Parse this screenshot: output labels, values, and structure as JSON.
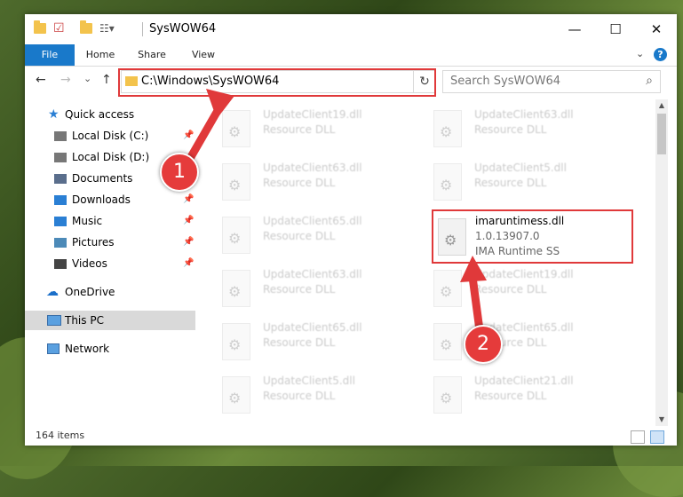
{
  "window": {
    "title": "SysWOW64",
    "minimize": "—",
    "maximize": "☐",
    "close": "✕"
  },
  "ribbon": {
    "tabs": [
      "File",
      "Home",
      "Share",
      "View"
    ],
    "help": "?",
    "caret": "⌄"
  },
  "address": {
    "path": "C:\\Windows\\SysWOW64",
    "caret": "⌄",
    "refresh": "↻"
  },
  "search": {
    "placeholder": "Search SysWOW64",
    "icon": "⌕"
  },
  "nav_buttons": {
    "back": "←",
    "forward": "→",
    "recent": "⌄",
    "up": "↑"
  },
  "nav": {
    "quick_access": "Quick access",
    "items": [
      {
        "label": "Local Disk (C:)",
        "icon": "drive-icon",
        "pinned": true
      },
      {
        "label": "Local Disk (D:)",
        "icon": "drive-icon",
        "pinned": false
      },
      {
        "label": "Documents",
        "icon": "documents-icon",
        "pinned": true
      },
      {
        "label": "Downloads",
        "icon": "downloads-icon",
        "pinned": true
      },
      {
        "label": "Music",
        "icon": "music-icon",
        "pinned": true
      },
      {
        "label": "Pictures",
        "icon": "pictures-icon",
        "pinned": true
      },
      {
        "label": "Videos",
        "icon": "videos-icon",
        "pinned": true
      }
    ],
    "onedrive": "OneDrive",
    "this_pc": "This PC",
    "network": "Network",
    "pin_glyph": "📌"
  },
  "files": [
    {
      "name": "UpdateClient19.dll",
      "desc": "Resource DLL",
      "col": 0,
      "row": 0
    },
    {
      "name": "UpdateClient63.dll",
      "desc": "Resource DLL",
      "col": 1,
      "row": 0
    },
    {
      "name": "UpdateClient63.dll",
      "desc": "Resource DLL",
      "col": 0,
      "row": 1
    },
    {
      "name": "UpdateClient5.dll",
      "desc": "Resource DLL",
      "col": 1,
      "row": 1
    },
    {
      "name": "UpdateClient65.dll",
      "desc": "Resource DLL",
      "col": 0,
      "row": 2
    },
    {
      "name": "UpdateClient63.dll",
      "desc": "Resource DLL",
      "col": 0,
      "row": 3
    },
    {
      "name": "UpdateClient19.dll",
      "desc": "Resource DLL",
      "col": 1,
      "row": 3
    },
    {
      "name": "UpdateClient65.dll",
      "desc": "Resource DLL",
      "col": 0,
      "row": 4
    },
    {
      "name": "UpdateClient65.dll",
      "desc": "Resource DLL",
      "col": 1,
      "row": 4
    },
    {
      "name": "UpdateClient5.dll",
      "desc": "Resource DLL",
      "col": 0,
      "row": 5
    },
    {
      "name": "UpdateClient21.dll",
      "desc": "Resource DLL",
      "col": 1,
      "row": 5
    }
  ],
  "highlight_file": {
    "name": "imaruntimess.dll",
    "version": "1.0.13907.0",
    "desc": "IMA Runtime SS"
  },
  "status": {
    "count": "164 items"
  },
  "annotations": {
    "badge1": "1",
    "badge2": "2",
    "color": "#e0393a"
  }
}
